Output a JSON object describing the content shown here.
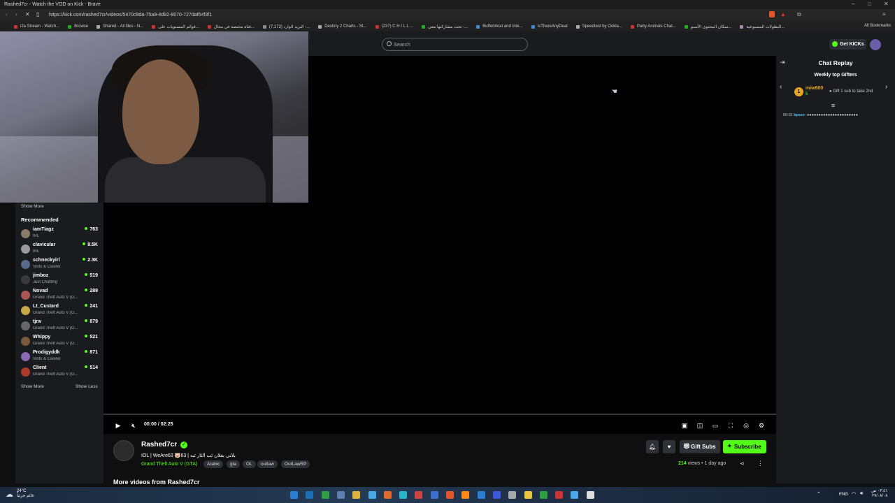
{
  "browser": {
    "window_title": "Rashed7cr - Watch the VOD on Kick - Brave",
    "url": "https://kick.com/rashed7cr/videos/5470c9da-75a9-4d92-8070-727daf64f3f1",
    "bookmarks": [
      "i2a Stream - Watch...",
      "Browse",
      "Shared - All files - N...",
      "قوائم المستويات على...",
      "قناة مختصة في مجال...",
      "(7,172) البريد الوارد -...",
      "Destiny 2 Charts - St...",
      "(237) C H I L L ...",
      "تحت مشاركتها معي -...",
      "Bufferbloat and Inte...",
      "IsThereAnyDeal",
      "Speedtest by Ookla...",
      "Party Animals Chat...",
      "سكان المحتوى الأسبو...",
      "البطولات المسبوعية..."
    ],
    "all_bookmarks": "All Bookmarks"
  },
  "header": {
    "search_placeholder": "Search",
    "get_kicks": "Get KICKs"
  },
  "sidebar": {
    "show_more_top": "Show More",
    "recommended_title": "Recommended",
    "channels": [
      {
        "name": "iamTiagz",
        "category": "IRL",
        "viewers": "763",
        "color": "#8a7a6a"
      },
      {
        "name": "clavicular",
        "category": "IRL",
        "viewers": "8.5K",
        "color": "#9a9a9a"
      },
      {
        "name": "schneckyirl",
        "category": "Slots & Casino",
        "viewers": "2.3K",
        "color": "#5a6a8a"
      },
      {
        "name": "jimboz",
        "category": "Just Chatting",
        "viewers": "519",
        "color": "#3a3a3a"
      },
      {
        "name": "Novad",
        "category": "Grand Theft Auto V (G...",
        "viewers": "289",
        "color": "#a55"
      },
      {
        "name": "Lt_Custard",
        "category": "Grand Theft Auto V (G...",
        "viewers": "241",
        "color": "#c9a84a"
      },
      {
        "name": "tjnv",
        "category": "Grand Theft Auto V (G...",
        "viewers": "879",
        "color": "#666"
      },
      {
        "name": "Whippy",
        "category": "Grand Theft Auto V (G...",
        "viewers": "521",
        "color": "#7a5a3a"
      },
      {
        "name": "Prodigyddk",
        "category": "Slots & Casino",
        "viewers": "871",
        "color": "#8a6ab0"
      },
      {
        "name": "Client",
        "category": "Grand Theft Auto V (G...",
        "viewers": "514",
        "color": "#b03a2a"
      }
    ],
    "show_more": "Show More",
    "show_less": "Show Less"
  },
  "player": {
    "time": "00:00 / 02:25",
    "progress_fraction": 0
  },
  "chat": {
    "title": "Chat Replay",
    "weekly_title": "Weekly top Gifters",
    "gifter_rank": "1",
    "gifter_name": "miw600",
    "gifter_count": "5",
    "gift_hint": "Gift 1 sub to take 2nd",
    "line_time": "00:01",
    "line_user": "bpsez",
    "line_text": ": ●●●●●●●●●●●●●●●●●●●●●●"
  },
  "channel": {
    "name": "Rashed7cr",
    "vod_title": "IOL | WeAre63 🐷63 | بلاني بفلان ثب الثار ثبه",
    "game": "Grand Theft Auto V (GTA)",
    "tags": [
      "Arabic",
      "gta",
      "OL",
      "outlaw",
      "OutLawRP"
    ],
    "gift_subs": "Gift Subs",
    "subscribe": "Subscribe",
    "views_count": "214",
    "views_label": "views",
    "age": "1 day ago",
    "more_videos": "More videos from Rashed7cr"
  },
  "taskbar": {
    "temp": "24°C",
    "weather": "غائم جزئياً",
    "lang": "ENG",
    "clock_time": "٠٣:٤١ ص",
    "clock_date": "٢٧/٠٨/٠٨"
  }
}
